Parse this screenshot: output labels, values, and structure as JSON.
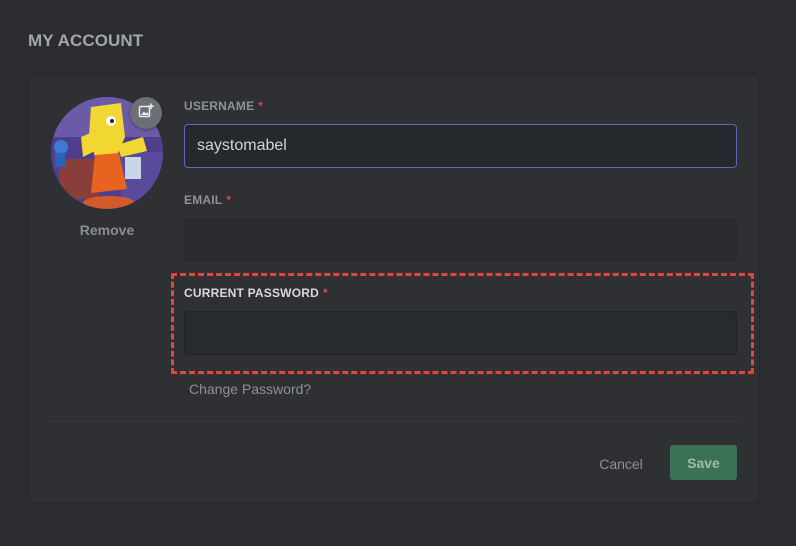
{
  "page": {
    "title": "MY ACCOUNT"
  },
  "avatar": {
    "remove_label": "Remove"
  },
  "fields": {
    "username": {
      "label": "USERNAME",
      "required_mark": "*",
      "value": "saystomabel"
    },
    "email": {
      "label": "EMAIL",
      "required_mark": "*",
      "value": ""
    },
    "current_password": {
      "label": "CURRENT PASSWORD",
      "required_mark": "*",
      "value": ""
    }
  },
  "links": {
    "change_password": "Change Password?"
  },
  "footer": {
    "cancel_label": "Cancel",
    "save_label": "Save"
  },
  "colors": {
    "background": "#2a2c30",
    "card": "#2e3034",
    "required": "#d34a4a",
    "highlight": "#e0483f",
    "save": "#3b7256",
    "focus_border": "#5c67b8"
  },
  "icons": {
    "avatar_upload": "add-image-icon"
  }
}
